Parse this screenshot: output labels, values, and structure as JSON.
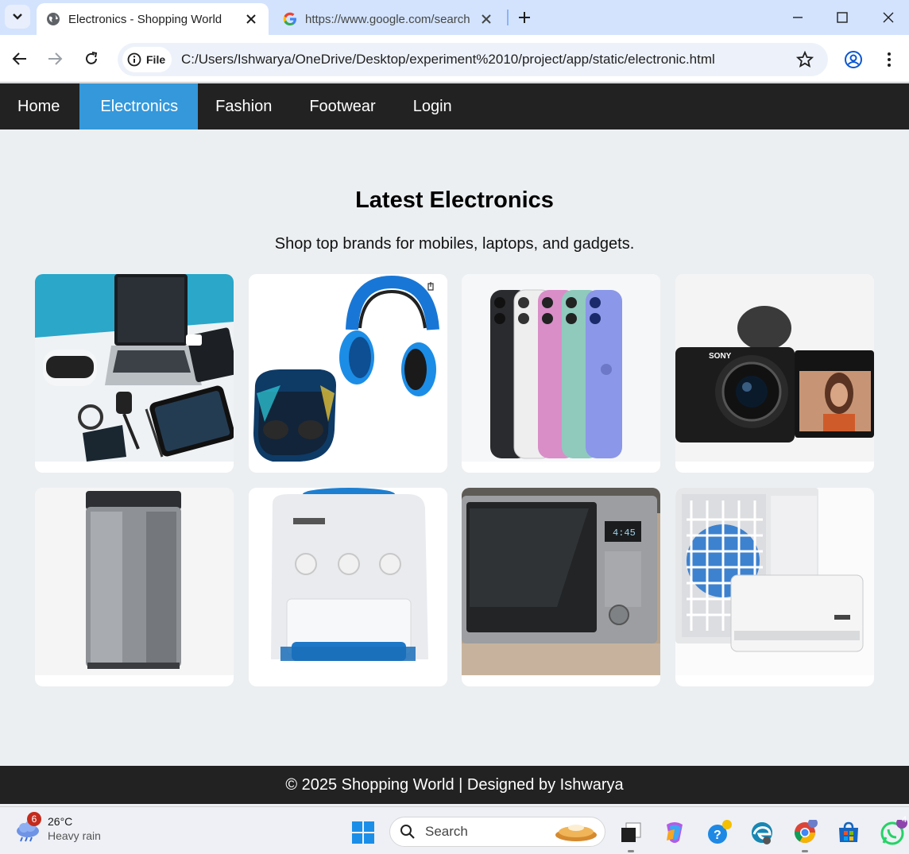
{
  "browser": {
    "tabs": [
      {
        "title": "Electronics - Shopping World",
        "active": true
      },
      {
        "title": "https://www.google.com/search",
        "active": false
      }
    ],
    "security_chip": "File",
    "url": "C:/Users/Ishwarya/OneDrive/Desktop/experiment%2010/project/app/static/electronic.html"
  },
  "site": {
    "nav": [
      {
        "label": "Home"
      },
      {
        "label": "Electronics",
        "active": true
      },
      {
        "label": "Fashion"
      },
      {
        "label": "Footwear"
      },
      {
        "label": "Login"
      }
    ],
    "heading": "Latest Electronics",
    "subheading": "Shop top brands for mobiles, laptops, and gadgets.",
    "products": [
      {
        "icon": "laptop-gadgets-image"
      },
      {
        "icon": "headphones-earbuds-image"
      },
      {
        "icon": "smartphones-image"
      },
      {
        "icon": "camera-image"
      },
      {
        "icon": "washing-machine-image"
      },
      {
        "icon": "water-dispenser-image"
      },
      {
        "icon": "microwave-image"
      },
      {
        "icon": "air-conditioner-image"
      }
    ],
    "footer": "© 2025 Shopping World | Designed by Ishwarya",
    "colors": {
      "nav_bg": "#222222",
      "nav_active": "#3498db",
      "page_bg": "#eceff1"
    }
  },
  "taskbar": {
    "weather": {
      "badge": "6",
      "temp": "26°C",
      "condition": "Heavy rain"
    },
    "search_placeholder": "Search",
    "whatsapp_badge": "4"
  }
}
